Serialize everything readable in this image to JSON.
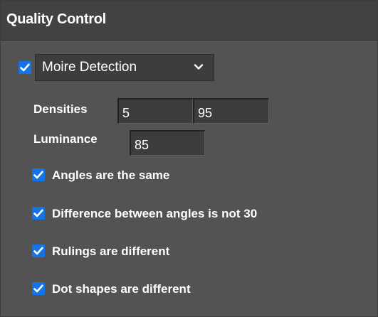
{
  "panel": {
    "title": "Quality Control"
  },
  "moire": {
    "enabled": true,
    "selected_mode": "Moire Detection"
  },
  "densities": {
    "label": "Densities",
    "min_value": "5",
    "max_value": "95"
  },
  "luminance": {
    "label": "Luminance",
    "value": "85"
  },
  "options": [
    {
      "label": "Angles are the same",
      "checked": true
    },
    {
      "label": "Difference between angles is not 30",
      "checked": true
    },
    {
      "label": "Rulings are different",
      "checked": true
    },
    {
      "label": "Dot shapes are different",
      "checked": true
    }
  ],
  "colors": {
    "panel_bg": "#535353",
    "header_bg": "#424242",
    "accent": "#1473e6",
    "text": "#ffffff"
  },
  "icons": {
    "checkbox": "checkmark-icon",
    "dropdown": "chevron-down-icon"
  }
}
